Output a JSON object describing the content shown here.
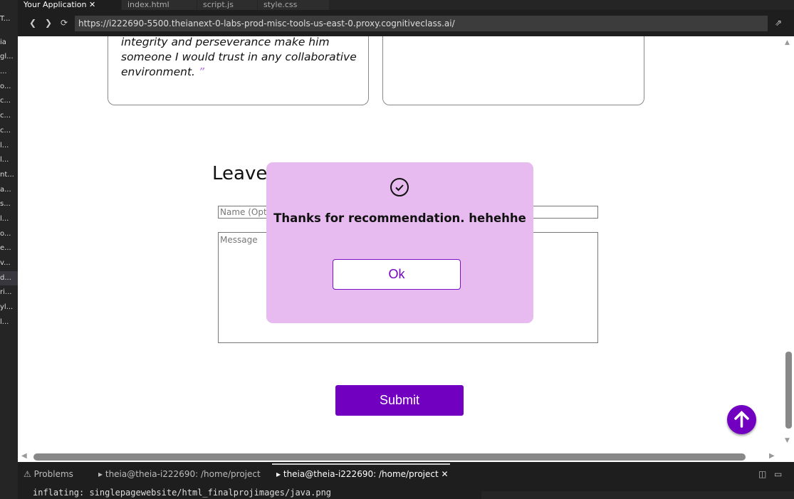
{
  "explorer": {
    "items": [
      "T...",
      "ia",
      "gl...",
      "...",
      "o...",
      "c...",
      "c...",
      "c...",
      "l...",
      "l...",
      "nt...",
      "a...",
      "s...",
      "l...",
      "o...",
      "e...",
      "v...",
      "d...",
      "ri...",
      "yl...",
      "l..."
    ]
  },
  "tabs": [
    {
      "label": "Your Application",
      "active": true
    },
    {
      "label": "index.html"
    },
    {
      "label": "script.js"
    },
    {
      "label": "style.css"
    }
  ],
  "browser": {
    "url": "https://i222690-5500.theianext-0-labs-prod-misc-tools-us-east-0.proxy.cognitiveclass.ai/"
  },
  "page": {
    "testimonial": {
      "lines": [
        "integrity and perseverance make him",
        "someone I would trust in any collaborative",
        "environment."
      ],
      "close_quote": "”"
    },
    "form": {
      "heading": "Leave",
      "name_placeholder": "Name (Optional)",
      "message_placeholder": "Message",
      "submit_label": "Submit"
    }
  },
  "dialog": {
    "message": "Thanks for recommendation. hehehhe",
    "ok_label": "Ok"
  },
  "panel": {
    "tabs": [
      {
        "label": "Problems"
      },
      {
        "label": "theia@theia-i222690: /home/project"
      },
      {
        "label": "theia@theia-i222690: /home/project",
        "active": true
      }
    ],
    "terminal_line": "inflating: singlepagewebsite/html_finalprojimages/java.png"
  },
  "colors": {
    "accent": "#7200c0",
    "dialog_bg": "#e8bbf0"
  }
}
